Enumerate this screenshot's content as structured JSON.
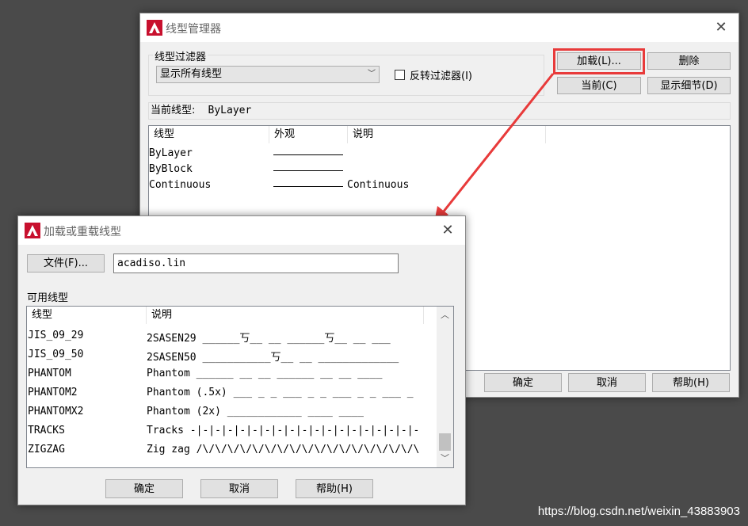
{
  "main_dialog": {
    "title": "线型管理器",
    "filter_group_label": "线型过滤器",
    "filter_value": "显示所有线型",
    "invert_filter_label": "反转过滤器(I)",
    "load_button": "加载(L)...",
    "delete_button": "删除",
    "current_button": "当前(C)",
    "show_details_button": "显示细节(D)",
    "current_linetype_label": "当前线型:",
    "current_linetype_value": "ByLayer",
    "columns": [
      "线型",
      "外观",
      "说明"
    ],
    "rows": [
      {
        "name": "ByLayer",
        "description": ""
      },
      {
        "name": "ByBlock",
        "description": ""
      },
      {
        "name": "Continuous",
        "description": "Continuous"
      }
    ],
    "ok_button": "确定",
    "cancel_button": "取消",
    "help_button": "帮助(H)"
  },
  "load_dialog": {
    "title": "加载或重载线型",
    "file_button": "文件(F)...",
    "file_value": "acadiso.lin",
    "available_label": "可用线型",
    "columns": [
      "线型",
      "说明"
    ],
    "rows": [
      {
        "name": "JIS_09_29",
        "description": "2SASEN29 ______丂__  __  ______丂__  __  ___"
      },
      {
        "name": "JIS_09_50",
        "description": "2SASEN50 ___________丂__  __  _____________"
      },
      {
        "name": "PHANTOM",
        "description": "Phantom ______  __  __  ______  __  __  ____"
      },
      {
        "name": "PHANTOM2",
        "description": "Phantom (.5x) ___ _ _ ___ _ _ ___ _ _ ___ _"
      },
      {
        "name": "PHANTOMX2",
        "description": "Phantom (2x) ____________    ____    ____"
      },
      {
        "name": "TRACKS",
        "description": "Tracks -|-|-|-|-|-|-|-|-|-|-|-|-|-|-|-|-|-|-"
      },
      {
        "name": "ZIGZAG",
        "description": "Zig zag /\\/\\/\\/\\/\\/\\/\\/\\/\\/\\/\\/\\/\\/\\/\\/\\/\\/\\"
      }
    ],
    "ok_button": "确定",
    "cancel_button": "取消",
    "help_button": "帮助(H)"
  },
  "annotation": {
    "highlight_color": "#e83a3a",
    "arrow_color": "#e83a3a"
  },
  "watermark": "https://blog.csdn.net/weixin_43883903",
  "icons": {
    "app": "autocad-logo-icon",
    "close": "close-icon"
  }
}
